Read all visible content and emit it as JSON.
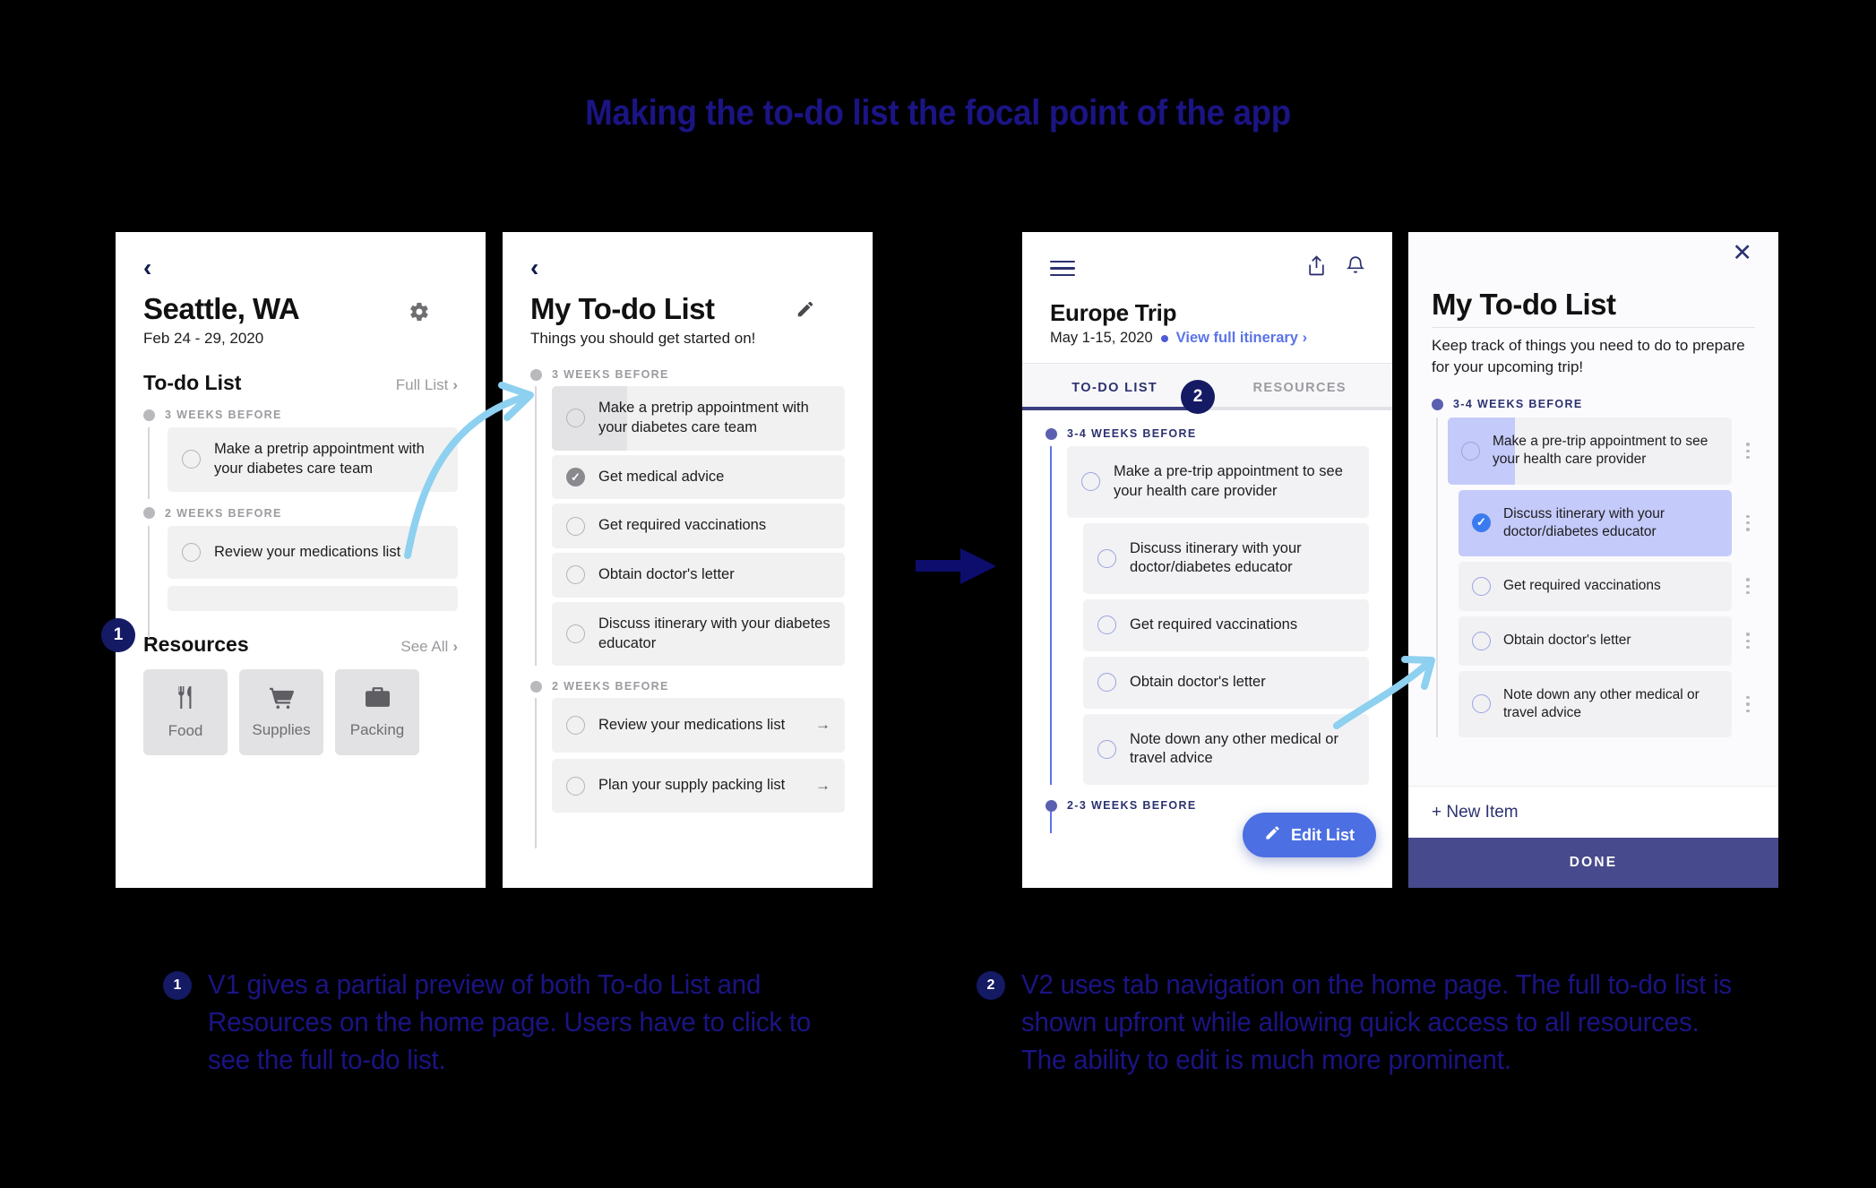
{
  "deck": {
    "title": "Making the to-do list the focal point of the app"
  },
  "screen1": {
    "back_icon": "‹",
    "title": "Seattle, WA",
    "dates": "Feb 24 - 29, 2020",
    "gear_icon": "⚙",
    "todo_section": {
      "heading": "To-do List",
      "link": "Full List",
      "chevron": "›"
    },
    "groups": [
      {
        "label": "3 WEEKS BEFORE",
        "items": [
          {
            "text": "Make a pretrip appointment with your diabetes care team",
            "checked": false
          }
        ]
      },
      {
        "label": "2 WEEKS BEFORE",
        "items": [
          {
            "text": "Review your medications list",
            "checked": false
          }
        ]
      }
    ],
    "resources_section": {
      "heading": "Resources",
      "link": "See All",
      "chevron": "›"
    },
    "tiles": [
      {
        "label": "Food",
        "icon": "food-icon",
        "glyph": "🍴"
      },
      {
        "label": "Supplies",
        "icon": "cart-icon",
        "glyph": "🛒"
      },
      {
        "label": "Packing",
        "icon": "briefcase-icon",
        "glyph": "💼"
      }
    ]
  },
  "screen2": {
    "back_icon": "‹",
    "title": "My To-do List",
    "subtitle": "Things you should get started on!",
    "edit_icon": "✏",
    "groups": [
      {
        "label": "3 WEEKS BEFORE",
        "items": [
          {
            "text": "Make a pretrip appointment with your diabetes care team",
            "checked": false,
            "dragging": true
          },
          {
            "text": "Get medical advice",
            "checked": true
          },
          {
            "text": "Get required vaccinations",
            "checked": false
          },
          {
            "text": "Obtain doctor's letter",
            "checked": false
          },
          {
            "text": "Discuss itinerary with your diabetes educator",
            "checked": false
          }
        ]
      },
      {
        "label": "2 WEEKS BEFORE",
        "items": [
          {
            "text": "Review your medications list",
            "checked": false,
            "arrow": "→"
          },
          {
            "text": "Plan your supply packing list",
            "checked": false,
            "arrow": "→"
          }
        ]
      }
    ]
  },
  "screen3": {
    "menu_icon": "hamburger-icon",
    "share_icon": "⇧",
    "bell_icon": "🔔",
    "trip_title": "Europe Trip",
    "trip_dates": "May 1-15, 2020",
    "itinerary_link": "View full itinerary",
    "itinerary_chevron": "›",
    "tabs": [
      {
        "label": "TO-DO LIST",
        "active": true
      },
      {
        "label": "RESOURCES",
        "active": false
      }
    ],
    "groups": [
      {
        "label": "3-4 WEEKS BEFORE",
        "items": [
          {
            "text": "Make a pre-trip appointment to see your health care provider",
            "checked": false
          },
          {
            "text": "Discuss itinerary with your doctor/diabetes educator",
            "checked": false
          },
          {
            "text": "Get required vaccinations",
            "checked": false
          },
          {
            "text": "Obtain doctor's letter",
            "checked": false
          },
          {
            "text": "Note down any other medical or travel advice",
            "checked": false
          }
        ]
      },
      {
        "label": "2-3 WEEKS BEFORE",
        "items": []
      }
    ],
    "fab": {
      "label": "Edit List",
      "icon": "pencil-icon"
    }
  },
  "screen4": {
    "close_icon": "✕",
    "title": "My To-do List",
    "subtitle": "Keep track of things you need to do to prepare for your upcoming trip!",
    "group_label": "3-4 WEEKS BEFORE",
    "items": [
      {
        "text": "Make a pre-trip appointment to see your health care provider",
        "checked": false,
        "swiped": true
      },
      {
        "text": "Discuss itinerary with your doctor/diabetes educator",
        "checked": true,
        "selected": true
      },
      {
        "text": "Get required vaccinations",
        "checked": false
      },
      {
        "text": "Obtain doctor's letter",
        "checked": false
      },
      {
        "text": "Note down any other medical or travel advice",
        "checked": false
      }
    ],
    "new_item_label": "+ New Item",
    "done_label": "DONE"
  },
  "annotations": {
    "badge1": "1",
    "badge2": "2",
    "caption1": {
      "number": "1",
      "text": "V1 gives a partial preview of both To-do List and Resources on the home page. Users have to click to see the full to-do list."
    },
    "caption2": {
      "number": "2",
      "text": "V2 uses tab navigation on the home page. The full to-do list is shown upfront while allowing quick access to all resources. The ability to edit is much more prominent."
    }
  },
  "colors": {
    "brand_navy": "#141a63",
    "accent_blue": "#4C6FE3",
    "annotation_arrow": "#8ED0F0",
    "done_bar": "#474a8c",
    "selected_row": "#c4caf9"
  }
}
